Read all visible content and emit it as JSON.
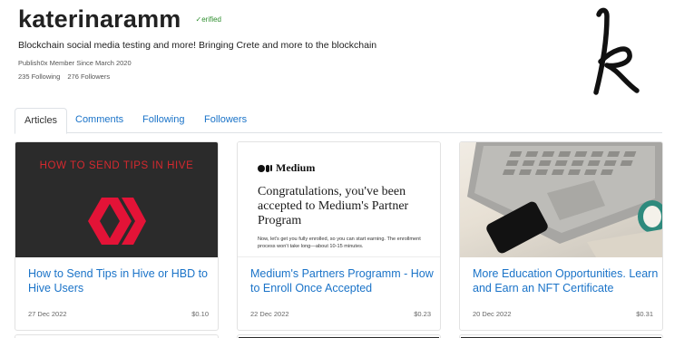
{
  "profile": {
    "username": "katerinaramm",
    "verified_label": "erified",
    "bio": "Blockchain social media testing and more! Bringing Crete and more to the blockchain",
    "member_since": "Publish0x Member Since March 2020",
    "following": "235 Following",
    "followers": "276 Followers"
  },
  "tabs": [
    {
      "label": "Articles",
      "active": true
    },
    {
      "label": "Comments",
      "active": false
    },
    {
      "label": "Following",
      "active": false
    },
    {
      "label": "Followers",
      "active": false
    }
  ],
  "articles": [
    {
      "title": "How to Send Tips in Hive or HBD to Hive Users",
      "date": "27 Dec 2022",
      "price": "$0.10",
      "image_headline": "HOW TO SEND TIPS IN HIVE"
    },
    {
      "title": "Medium's Partners Programm - How to Enroll Once Accepted",
      "date": "22 Dec 2022",
      "price": "$0.23",
      "image_brand": "Medium",
      "image_headline": "Congratulations, you've been accepted to Medium's Partner Program",
      "image_body": "Now, let's get you fully enrolled, so you can start earning. The enrollment process won't take long—about 10-15 minutes."
    },
    {
      "title": "More Education Opportunities. Learn and Earn an NFT Certificate",
      "date": "20 Dec 2022",
      "price": "$0.31"
    }
  ],
  "colors": {
    "link": "#1a73c8",
    "verified": "#2f8f2f",
    "hive_red": "#e31337"
  }
}
